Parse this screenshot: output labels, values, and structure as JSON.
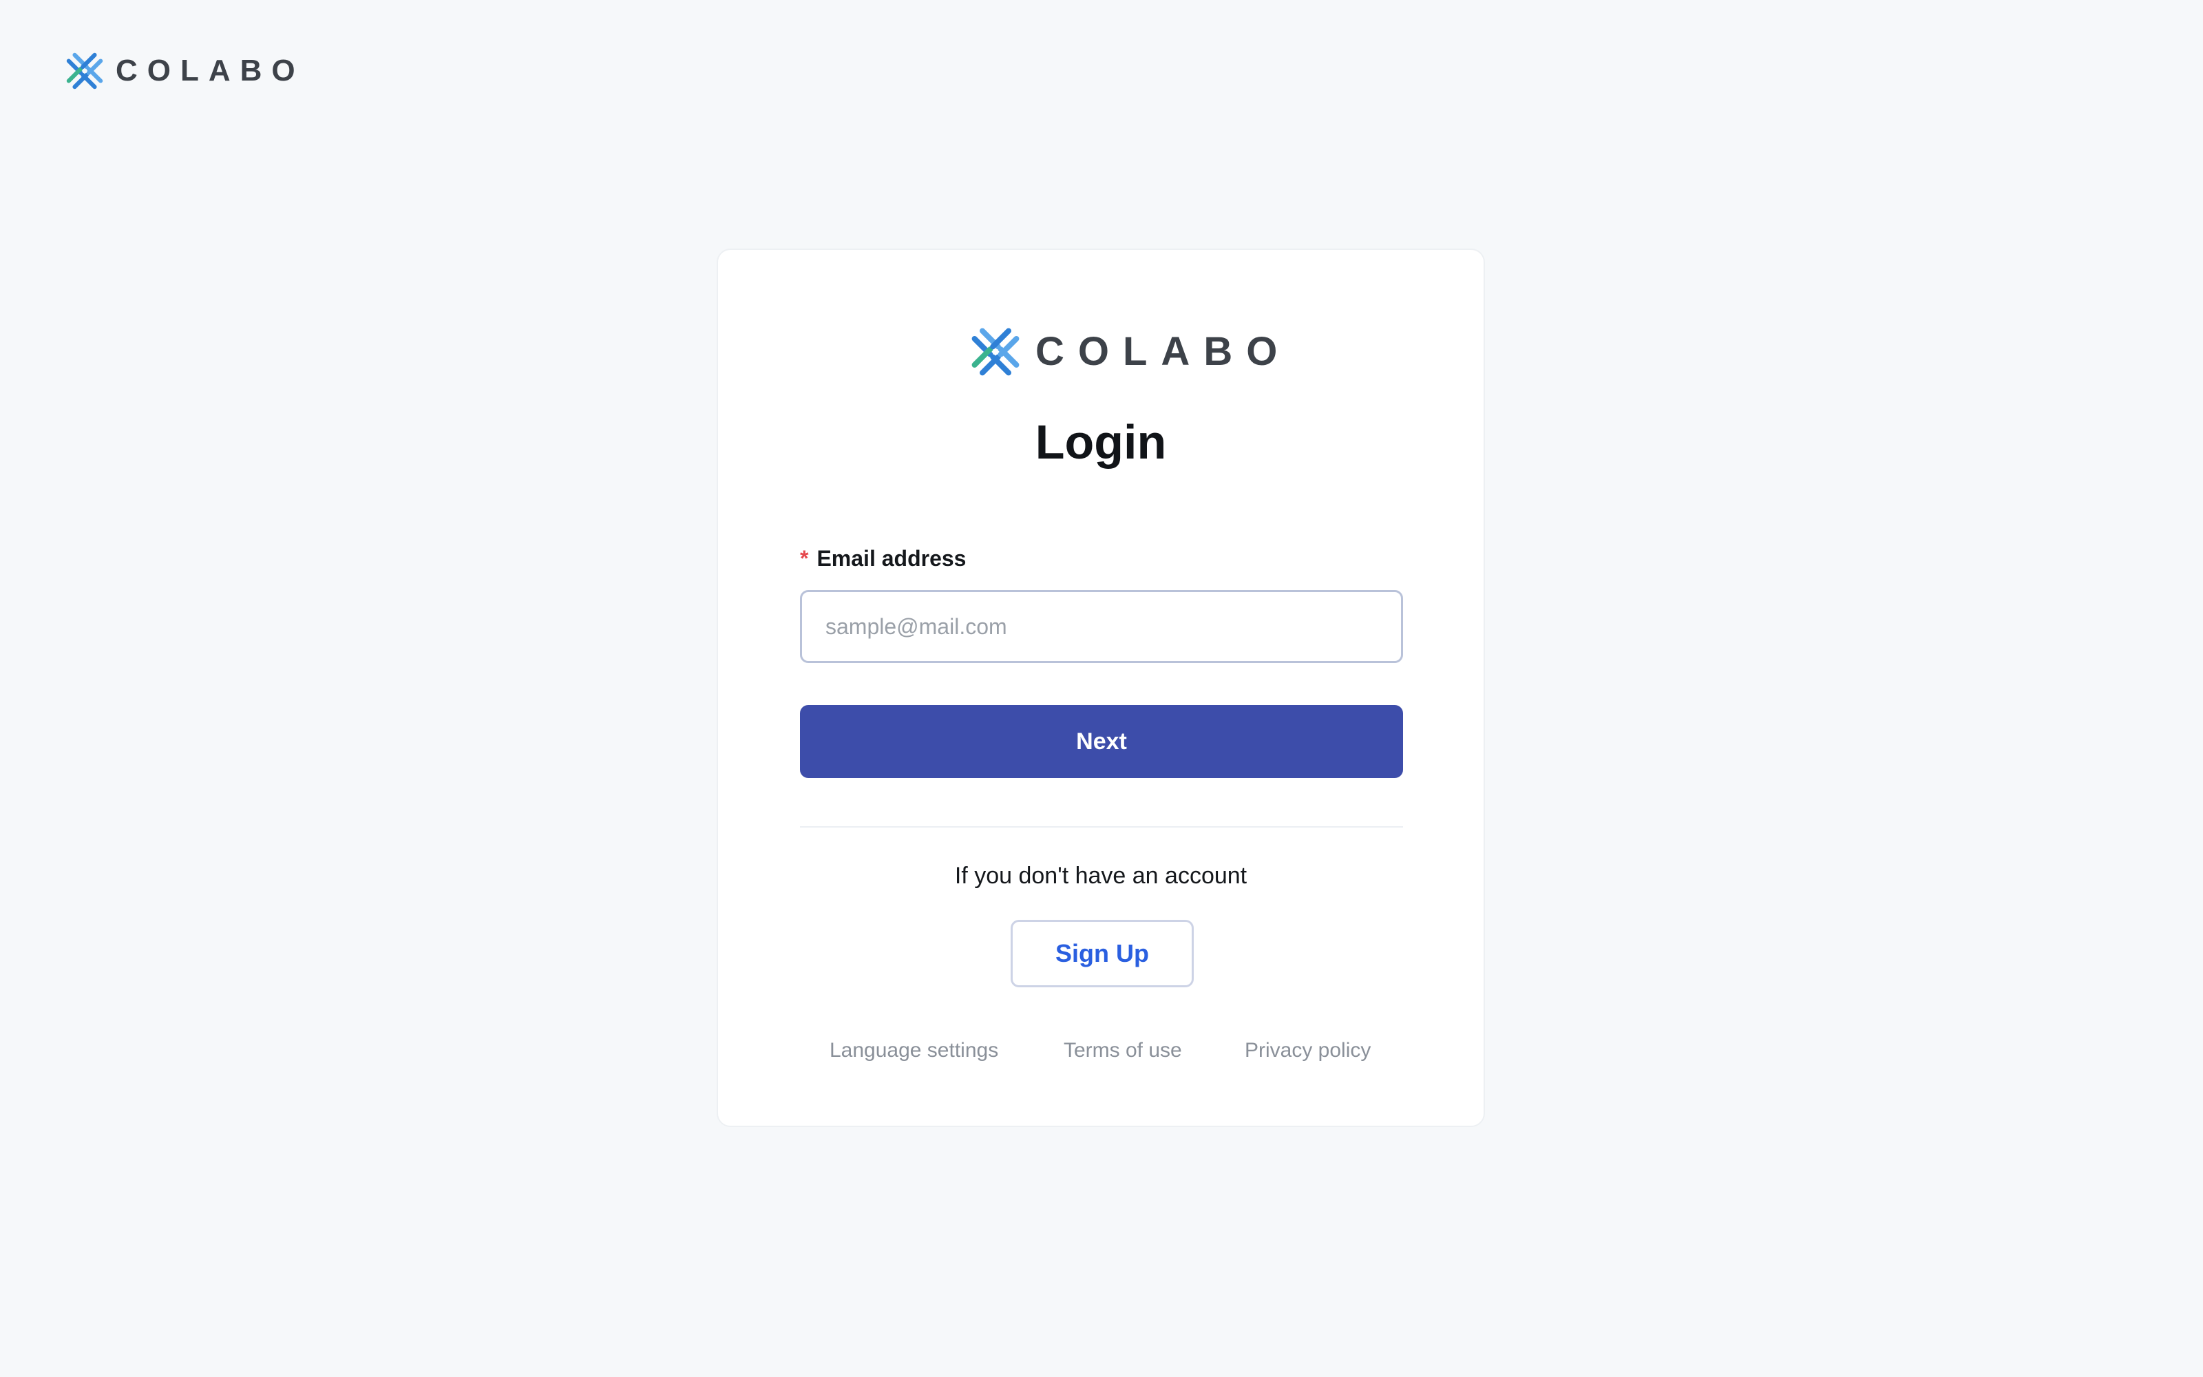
{
  "brand": {
    "name": "COLABO",
    "colors": {
      "blue": "#2f80d6",
      "light_blue": "#5aa6ea",
      "green": "#3bb38f",
      "wordmark": "#3d4249"
    }
  },
  "login": {
    "title": "Login",
    "email_label": "Email address",
    "required_marker": "*",
    "email_placeholder": "sample@mail.com",
    "email_value": "",
    "next_label": "Next",
    "signup_prompt": "If you don't have an account",
    "signup_label": "Sign Up",
    "accent_color": "#3d4daa"
  },
  "footer": {
    "links": [
      {
        "label": "Language settings"
      },
      {
        "label": "Terms of use"
      },
      {
        "label": "Privacy policy"
      }
    ]
  }
}
